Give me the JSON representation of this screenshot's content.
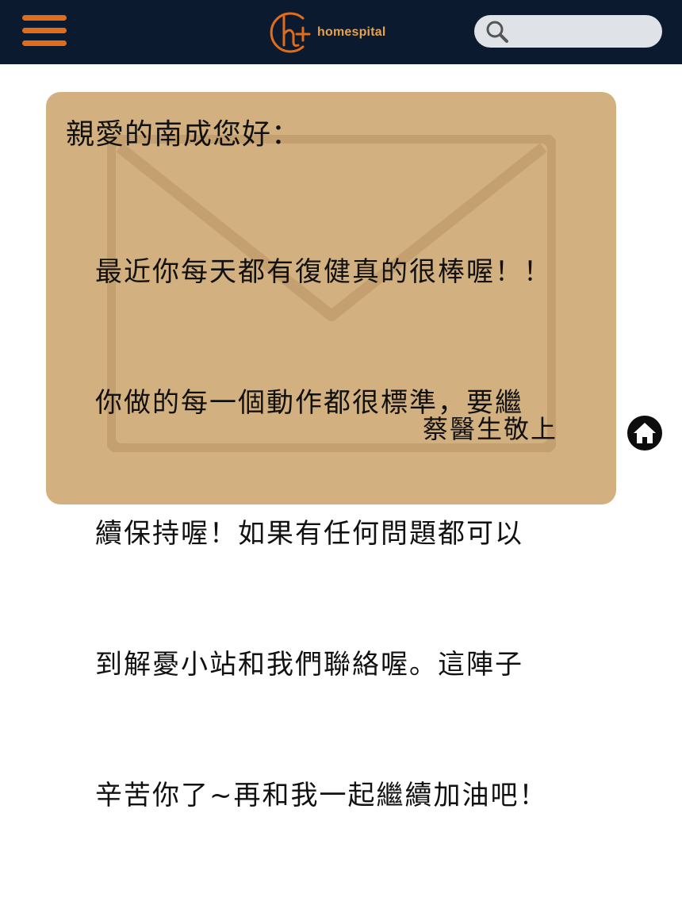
{
  "header": {
    "brand": "homespital",
    "search": {
      "placeholder": "",
      "value": ""
    },
    "colors": {
      "bar": "#0b1a2e",
      "accent": "#e06d1b",
      "brand_text": "#e8a14a",
      "search_bg": "#dfe2e6"
    }
  },
  "icons": {
    "menu": "hamburger-menu-icon",
    "logo": "homespital-logo-icon",
    "search": "search-icon",
    "envelope": "envelope-icon",
    "home": "home-icon"
  },
  "letter": {
    "greeting": "親愛的南成您好：",
    "lines": [
      "最近你每天都有復健真的很棒喔！！",
      "你做的每一個動作都很標準，要繼",
      "續保持喔！如果有任何問題都可以",
      "到解憂小站和我們聯絡喔。這陣子",
      "辛苦你了~再和我一起繼續加油吧！"
    ],
    "signature": "蔡醫生敬上",
    "background": "#d2b07f"
  }
}
